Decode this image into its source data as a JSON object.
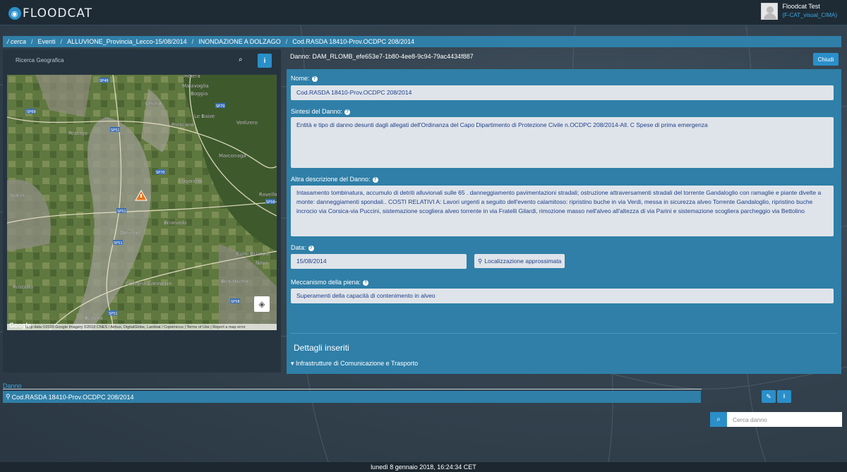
{
  "app": {
    "logo_text": "FLOODCAT"
  },
  "user": {
    "name": "Floodcat Test",
    "group": "(F-CAT_visual_CIMA)"
  },
  "breadcrumb": [
    "/ cerca",
    "Eventi",
    "ALLUVIONE_Provincia_Lecco-15/08/2014",
    "INONDAZIONE A DOLZAGO",
    "Cod.RASDA 18410-Prov.OCDPC 208/2014"
  ],
  "geo_search": {
    "placeholder": "Ricerca Geografica"
  },
  "map": {
    "place_labels": [
      "Molera",
      "Malavoglia",
      "Boggia",
      "Chiaro",
      "Le Baize",
      "Vedizero",
      "Peslago",
      "Prescano",
      "Marconaga",
      "Cogoredo",
      "Stona",
      "Ravellino",
      "Brianzola",
      "Dolzago",
      "Colle Brianza",
      "Nava",
      "Ruscollo",
      "Cologna-Caraverio",
      "Biecastello",
      "Beveco"
    ],
    "road_labels": [
      "SP49",
      "SP69",
      "SP70",
      "SP51",
      "SP70",
      "SP58",
      "SP51",
      "SP51",
      "SP51",
      "SP58"
    ],
    "attribution": "Map data ©2018 Google Imagery ©2018 CNES / Airbus, DigitalGlobe, Landsat / Copernicus | Terms of Use | Report a map error",
    "google": "Google"
  },
  "detail": {
    "danno_id": "Danno: DAM_RLOMB_efe653e7-1b80-4ee8-9c94-79ac4434f887",
    "close_label": "Chiudi",
    "nome_label": "Nome:",
    "nome_value": "Cod.RASDA 18410-Prov.OCDPC 208/2014",
    "sintesi_label": "Sintesi del Danno:",
    "sintesi_value": "Entità e tipo di danno desunti dagli allegati dell'Ordinanza del Capo Dipartimento di Protezione Civile n.OCDPC 208/2014-All. C Spese di prima emergenza",
    "altra_label": "Altra descrizione del Danno:",
    "altra_value": "Intasamento tombinatura, accumulo di detriti alluvionali sulle 65 . danneggiamento pavimentazioni stradali; ostruzione attraversamenti stradali del torrente Gandaloglio con ramaglie e piante divelte a monte: danneggiamenti spondali.. COSTI RELATIVI A: Lavori urgenti a seguito dell'evento calamitoso: ripristino buche in via Verdi, messa in sicurezza alveo Torrente Gandaloglio, ripristino buche incrocio via Corsica-via Puccini, sistemazione scogliera alveo torrente in via Fratelli Gilardi, rimozione masso nell'alveo all'altezza di via Parini e sistemazione scogliera parcheggio via Bettolino",
    "data_label": "Data:",
    "data_value": "15/08/2014",
    "loc_label": "Localizzazione approssimata",
    "meccanismo_label": "Meccanismo della piena:",
    "meccanismo_value": "Superamenti della capacità di contenimento in alveo",
    "dettagli_title": "Dettagli inseriti",
    "infra_label": "Infrastrutture di Comunicazione e Trasporto"
  },
  "bottom": {
    "danno_label": "Danno",
    "danno_row": "Cod.RASDA 18410-Prov.OCDPC 208/2014",
    "search_placeholder": "Cerca danno"
  },
  "footer": {
    "datetime": "lunedì 8 gennaio 2018, 16:24:34 CET"
  },
  "colors": {
    "accent": "#2a8fc9",
    "panel": "#2f7fa8",
    "field_text": "#1f3f8a"
  }
}
